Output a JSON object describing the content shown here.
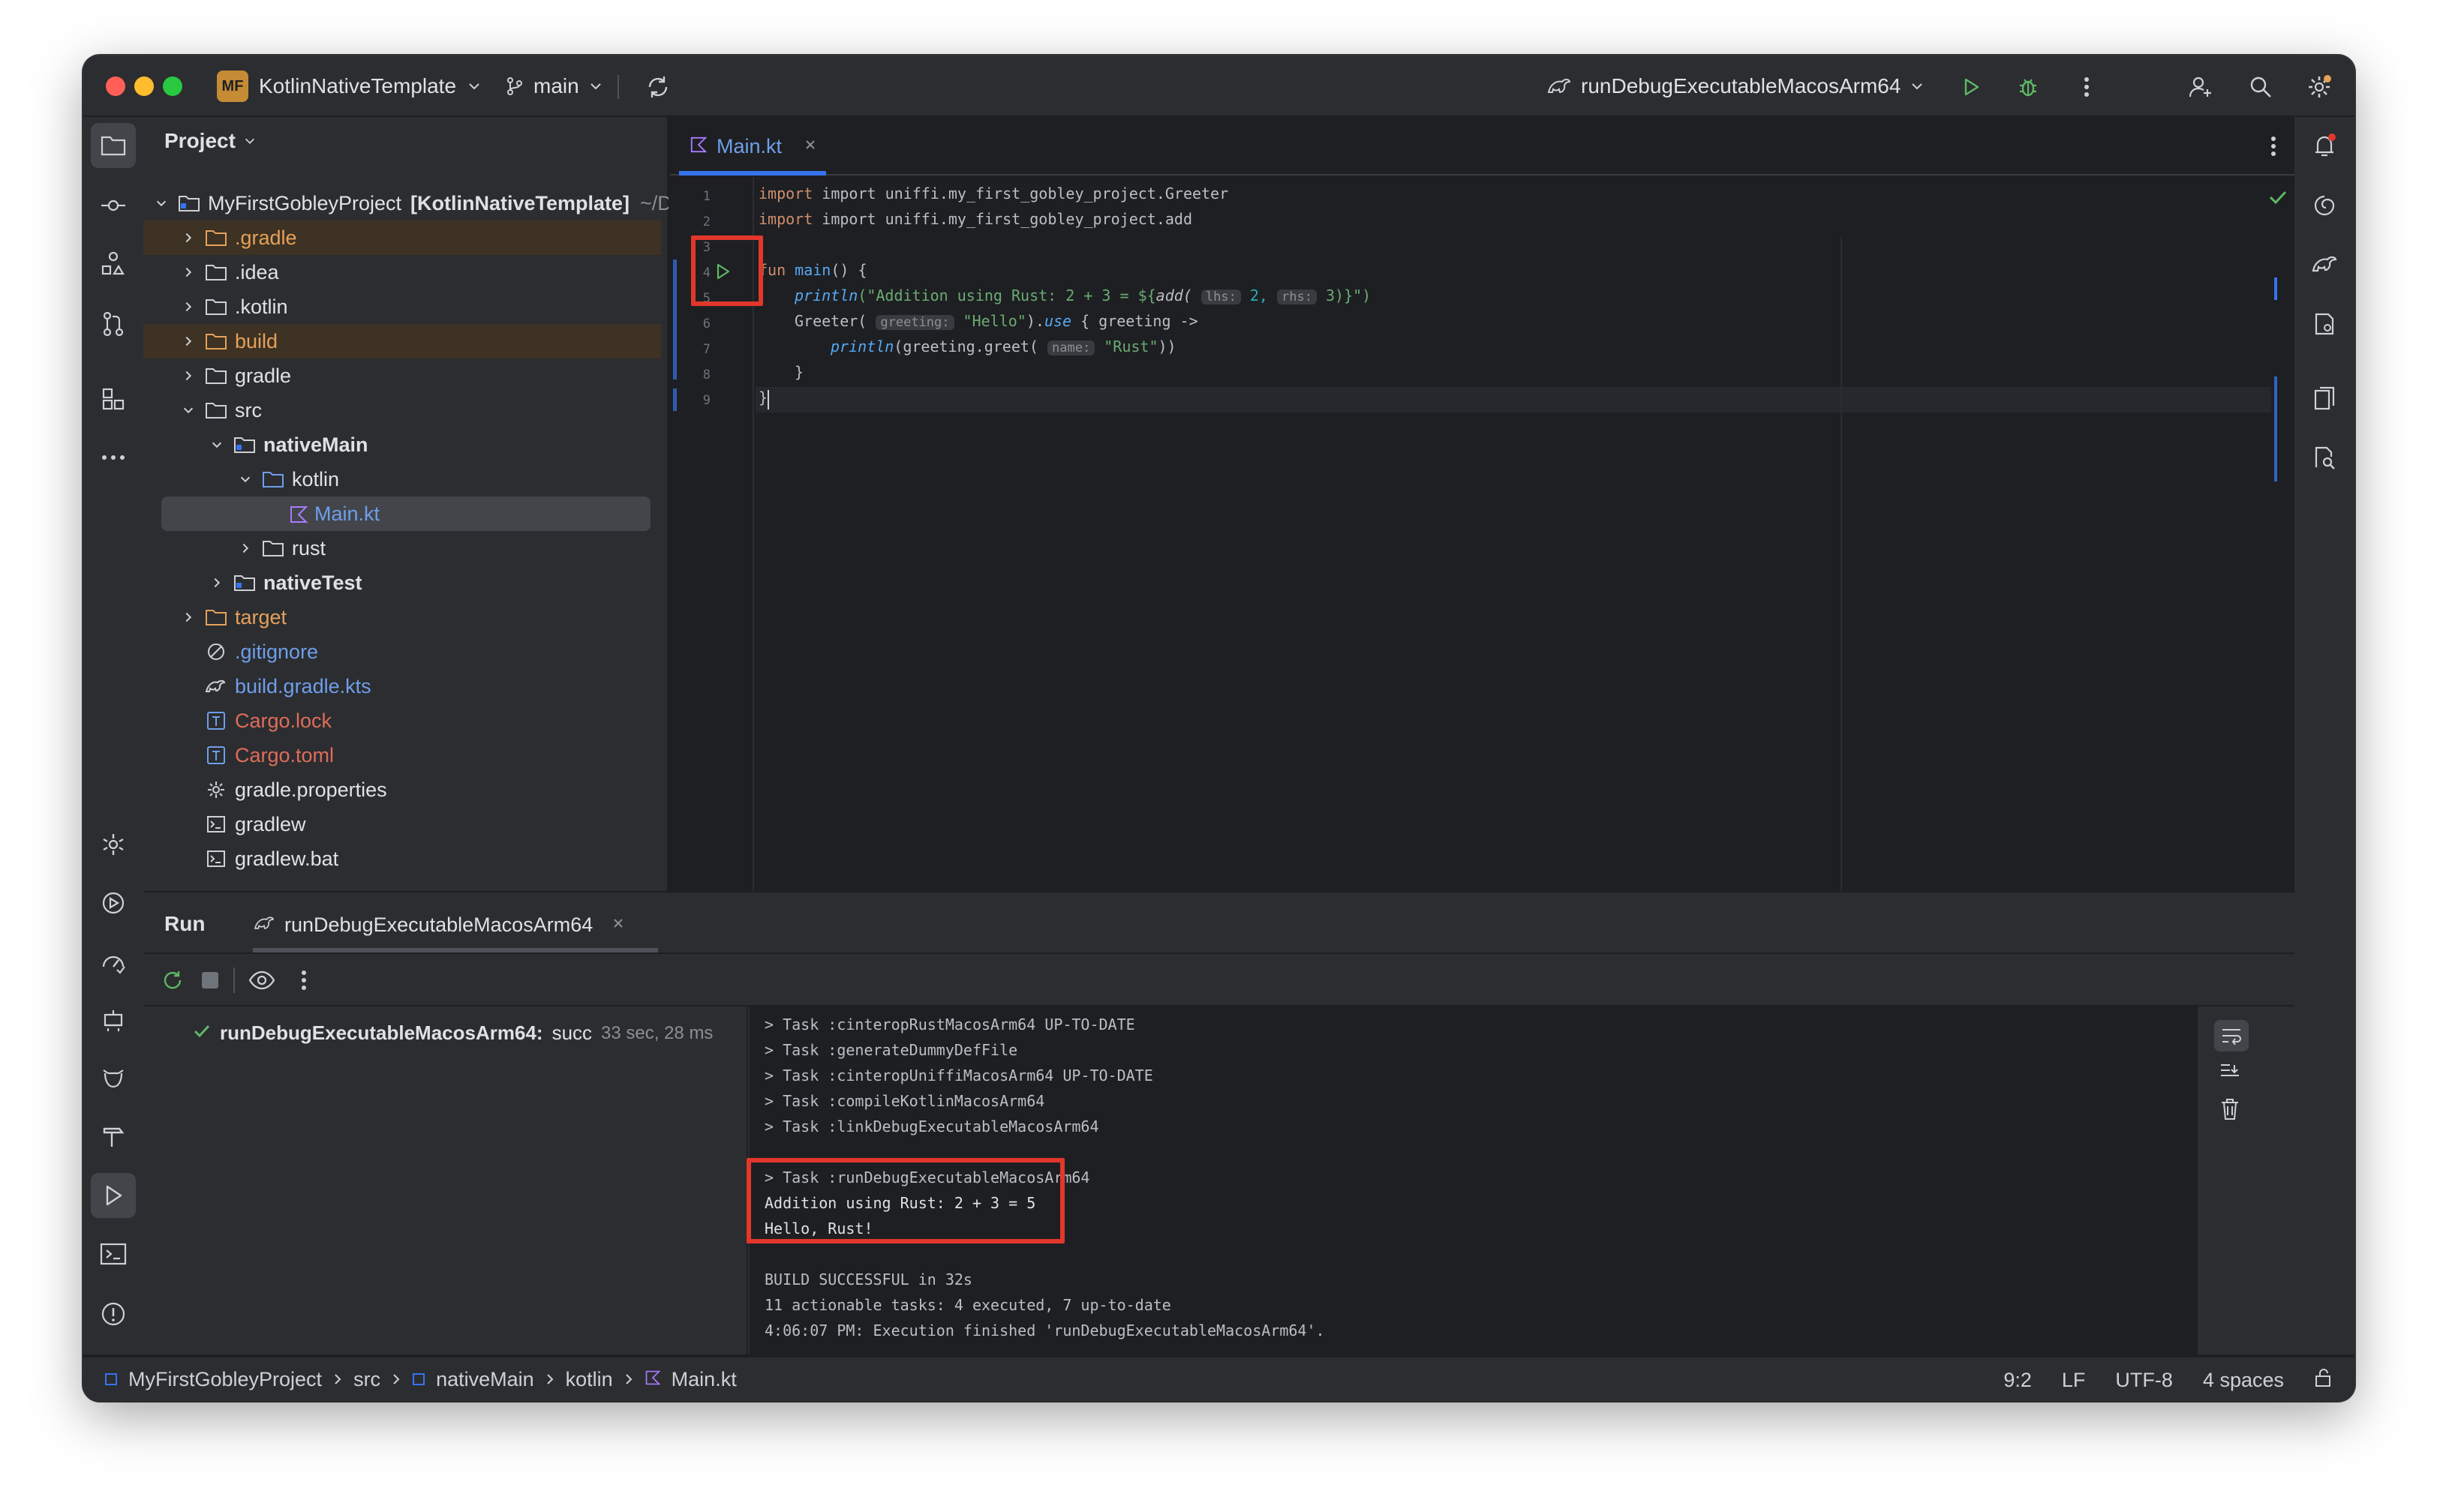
{
  "titlebar": {
    "project_badge": "MF",
    "project_name": "KotlinNativeTemplate",
    "branch": "main",
    "run_config": "runDebugExecutableMacosArm64"
  },
  "project_panel": {
    "title": "Project",
    "root": {
      "name": "MyFirstGobleyProject",
      "module": "[KotlinNativeTemplate]",
      "path": "~/D"
    },
    "items": [
      {
        "label": ".gradle"
      },
      {
        "label": ".idea"
      },
      {
        "label": ".kotlin"
      },
      {
        "label": "build"
      },
      {
        "label": "gradle"
      },
      {
        "label": "src"
      },
      {
        "label": "nativeMain"
      },
      {
        "label": "kotlin"
      },
      {
        "label": "Main.kt"
      },
      {
        "label": "rust"
      },
      {
        "label": "nativeTest"
      },
      {
        "label": "target"
      },
      {
        "label": ".gitignore"
      },
      {
        "label": "build.gradle.kts"
      },
      {
        "label": "Cargo.lock"
      },
      {
        "label": "Cargo.toml"
      },
      {
        "label": "gradle.properties"
      },
      {
        "label": "gradlew"
      },
      {
        "label": "gradlew.bat"
      }
    ]
  },
  "editor": {
    "tab": "Main.kt",
    "line_numbers": [
      "1",
      "2",
      "3",
      "4",
      "5",
      "6",
      "7",
      "8",
      "9"
    ],
    "code": {
      "l1": "import uniffi.my_first_gobley_project.Greeter",
      "l2": "import uniffi.my_first_gobley_project.add",
      "l4_kw": "fun",
      "l4_fn": "main",
      "l4_rest": "() {",
      "l5_fn": "println",
      "l5_str": "(\"Addition using Rust: 2 + 3 = ${",
      "l5_call": "add(",
      "l5_hint1": "lhs:",
      "l5_v1": "2,",
      "l5_hint2": "rhs:",
      "l5_v2": "3)}\")",
      "l6_a": "Greeter(",
      "l6_hint": "greeting:",
      "l6_str": "\"Hello\"",
      "l6_b": ").",
      "l6_use": "use",
      "l6_c": " { greeting ->",
      "l7_fn": "println",
      "l7_a": "(greeting.greet(",
      "l7_hint": "name:",
      "l7_str": "\"Rust\"",
      "l7_b": "))",
      "l8": "}",
      "l9": "}"
    }
  },
  "run_panel": {
    "title": "Run",
    "tab": "runDebugExecutableMacosArm64",
    "result_label": "runDebugExecutableMacosArm64:",
    "result_status": "succ",
    "result_time": "33 sec, 28 ms",
    "console_lines": [
      "> Task :cinteropRustMacosArm64 UP-TO-DATE",
      "> Task :generateDummyDefFile",
      "> Task :cinteropUniffiMacosArm64 UP-TO-DATE",
      "> Task :compileKotlinMacosArm64",
      "> Task :linkDebugExecutableMacosArm64",
      "",
      "> Task :runDebugExecutableMacosArm64",
      "Addition using Rust: 2 + 3 = 5",
      "Hello, Rust!",
      "",
      "BUILD SUCCESSFUL in 32s",
      "11 actionable tasks: 4 executed, 7 up-to-date",
      "4:06:07 PM: Execution finished 'runDebugExecutableMacosArm64'."
    ]
  },
  "statusbar": {
    "breadcrumbs": [
      "MyFirstGobleyProject",
      "src",
      "nativeMain",
      "kotlin",
      "Main.kt"
    ],
    "position": "9:2",
    "line_sep": "LF",
    "encoding": "UTF-8",
    "indent": "4 spaces"
  },
  "colors": {
    "accent": "#3574f0",
    "folder_excluded": "#e5a15a",
    "file_vcs_new": "#6f9eea",
    "cargo": "#e06c5a",
    "success": "#5fb865",
    "highlight": "#e2372b"
  }
}
